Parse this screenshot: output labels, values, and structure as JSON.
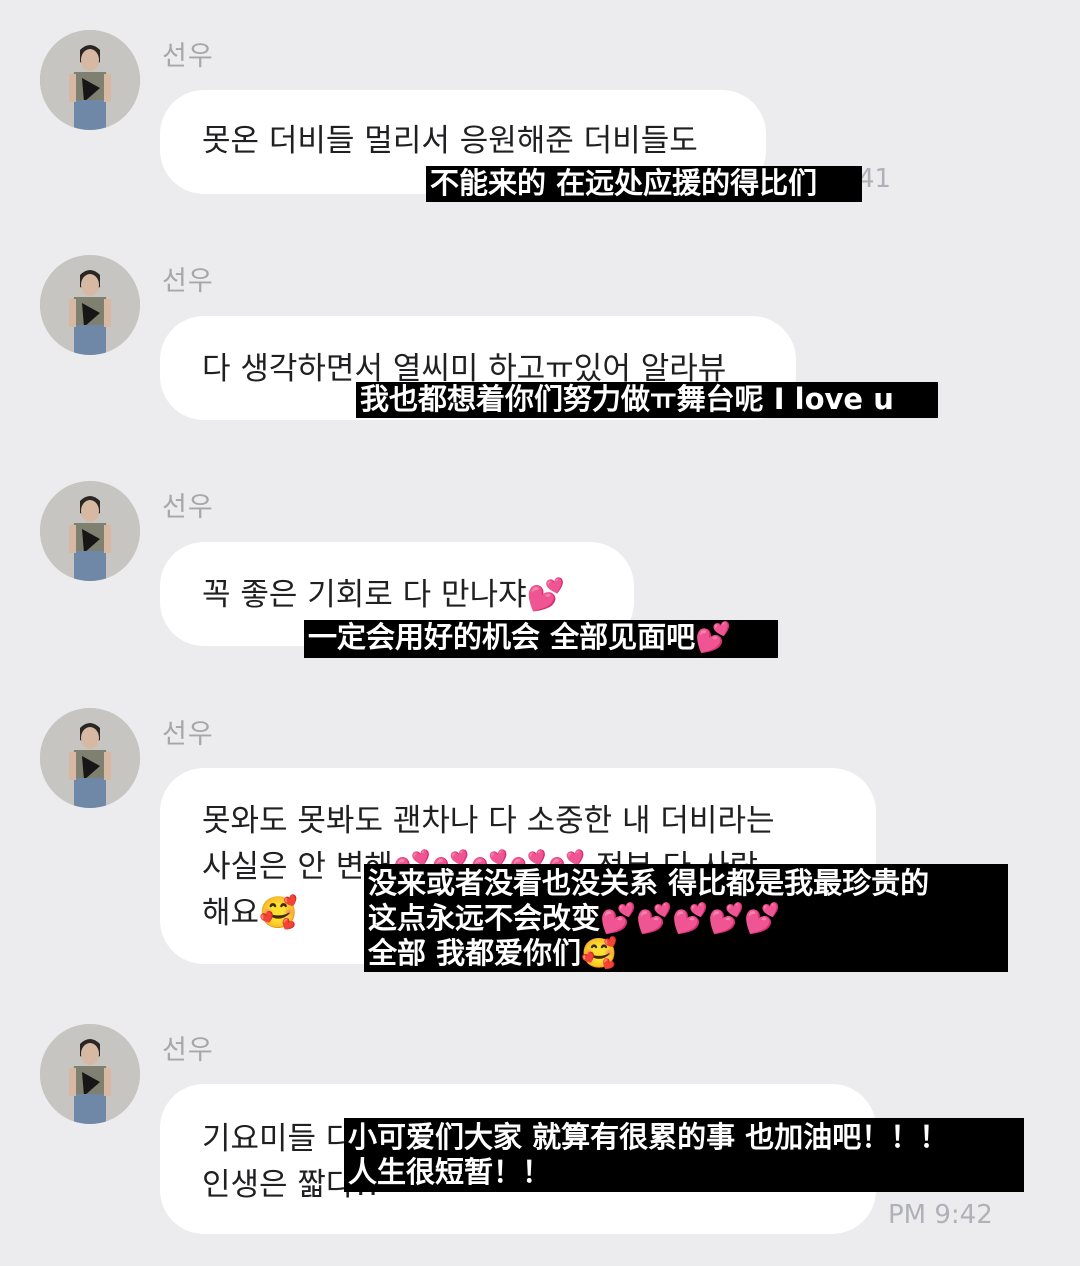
{
  "messages": [
    {
      "sender": "선우",
      "lines": [
        "못온 더비들 멀리서 응원해준 더비들도"
      ],
      "time": "41",
      "subtitle": [
        "不能来的 在远处应援的得比们"
      ]
    },
    {
      "sender": "선우",
      "lines": [
        "다 생각하면서 열씨미 하고ㅠ있어 알라뷰"
      ],
      "subtitle": [
        "我也都想着你们努力做ㅠ舞台呢 I love u"
      ]
    },
    {
      "sender": "선우",
      "lines": [
        "꼭 좋은 기회로 다 만나쟈💕"
      ],
      "subtitle": [
        "一定会用好的机会 全部见面吧💕"
      ]
    },
    {
      "sender": "선우",
      "lines": [
        "못와도 못봐도 괜차나 다 소중한 내 더비라는",
        "사실은 안 변해💕💕💕💕💕 전부 다 사랑",
        "해요🥰"
      ],
      "subtitle": [
        "没来或者没看也没关系 得比都是我最珍贵的",
        "这点永远不会改变💕💕💕💕💕",
        "全部 我都爱你们🥰"
      ]
    },
    {
      "sender": "선우",
      "lines": [
        "기요미들 다",
        "인생은 짧다!!"
      ],
      "time": "PM 9:42",
      "subtitle": [
        "小可爱们大家 就算有很累的事 也加油吧！！！",
        "人生很短暂！！"
      ]
    }
  ],
  "colors": {
    "background": "#ececee",
    "bubble": "#ffffff",
    "sender": "#a7a7ab",
    "subtitle_bg": "#000000",
    "subtitle_text": "#ffffff"
  }
}
